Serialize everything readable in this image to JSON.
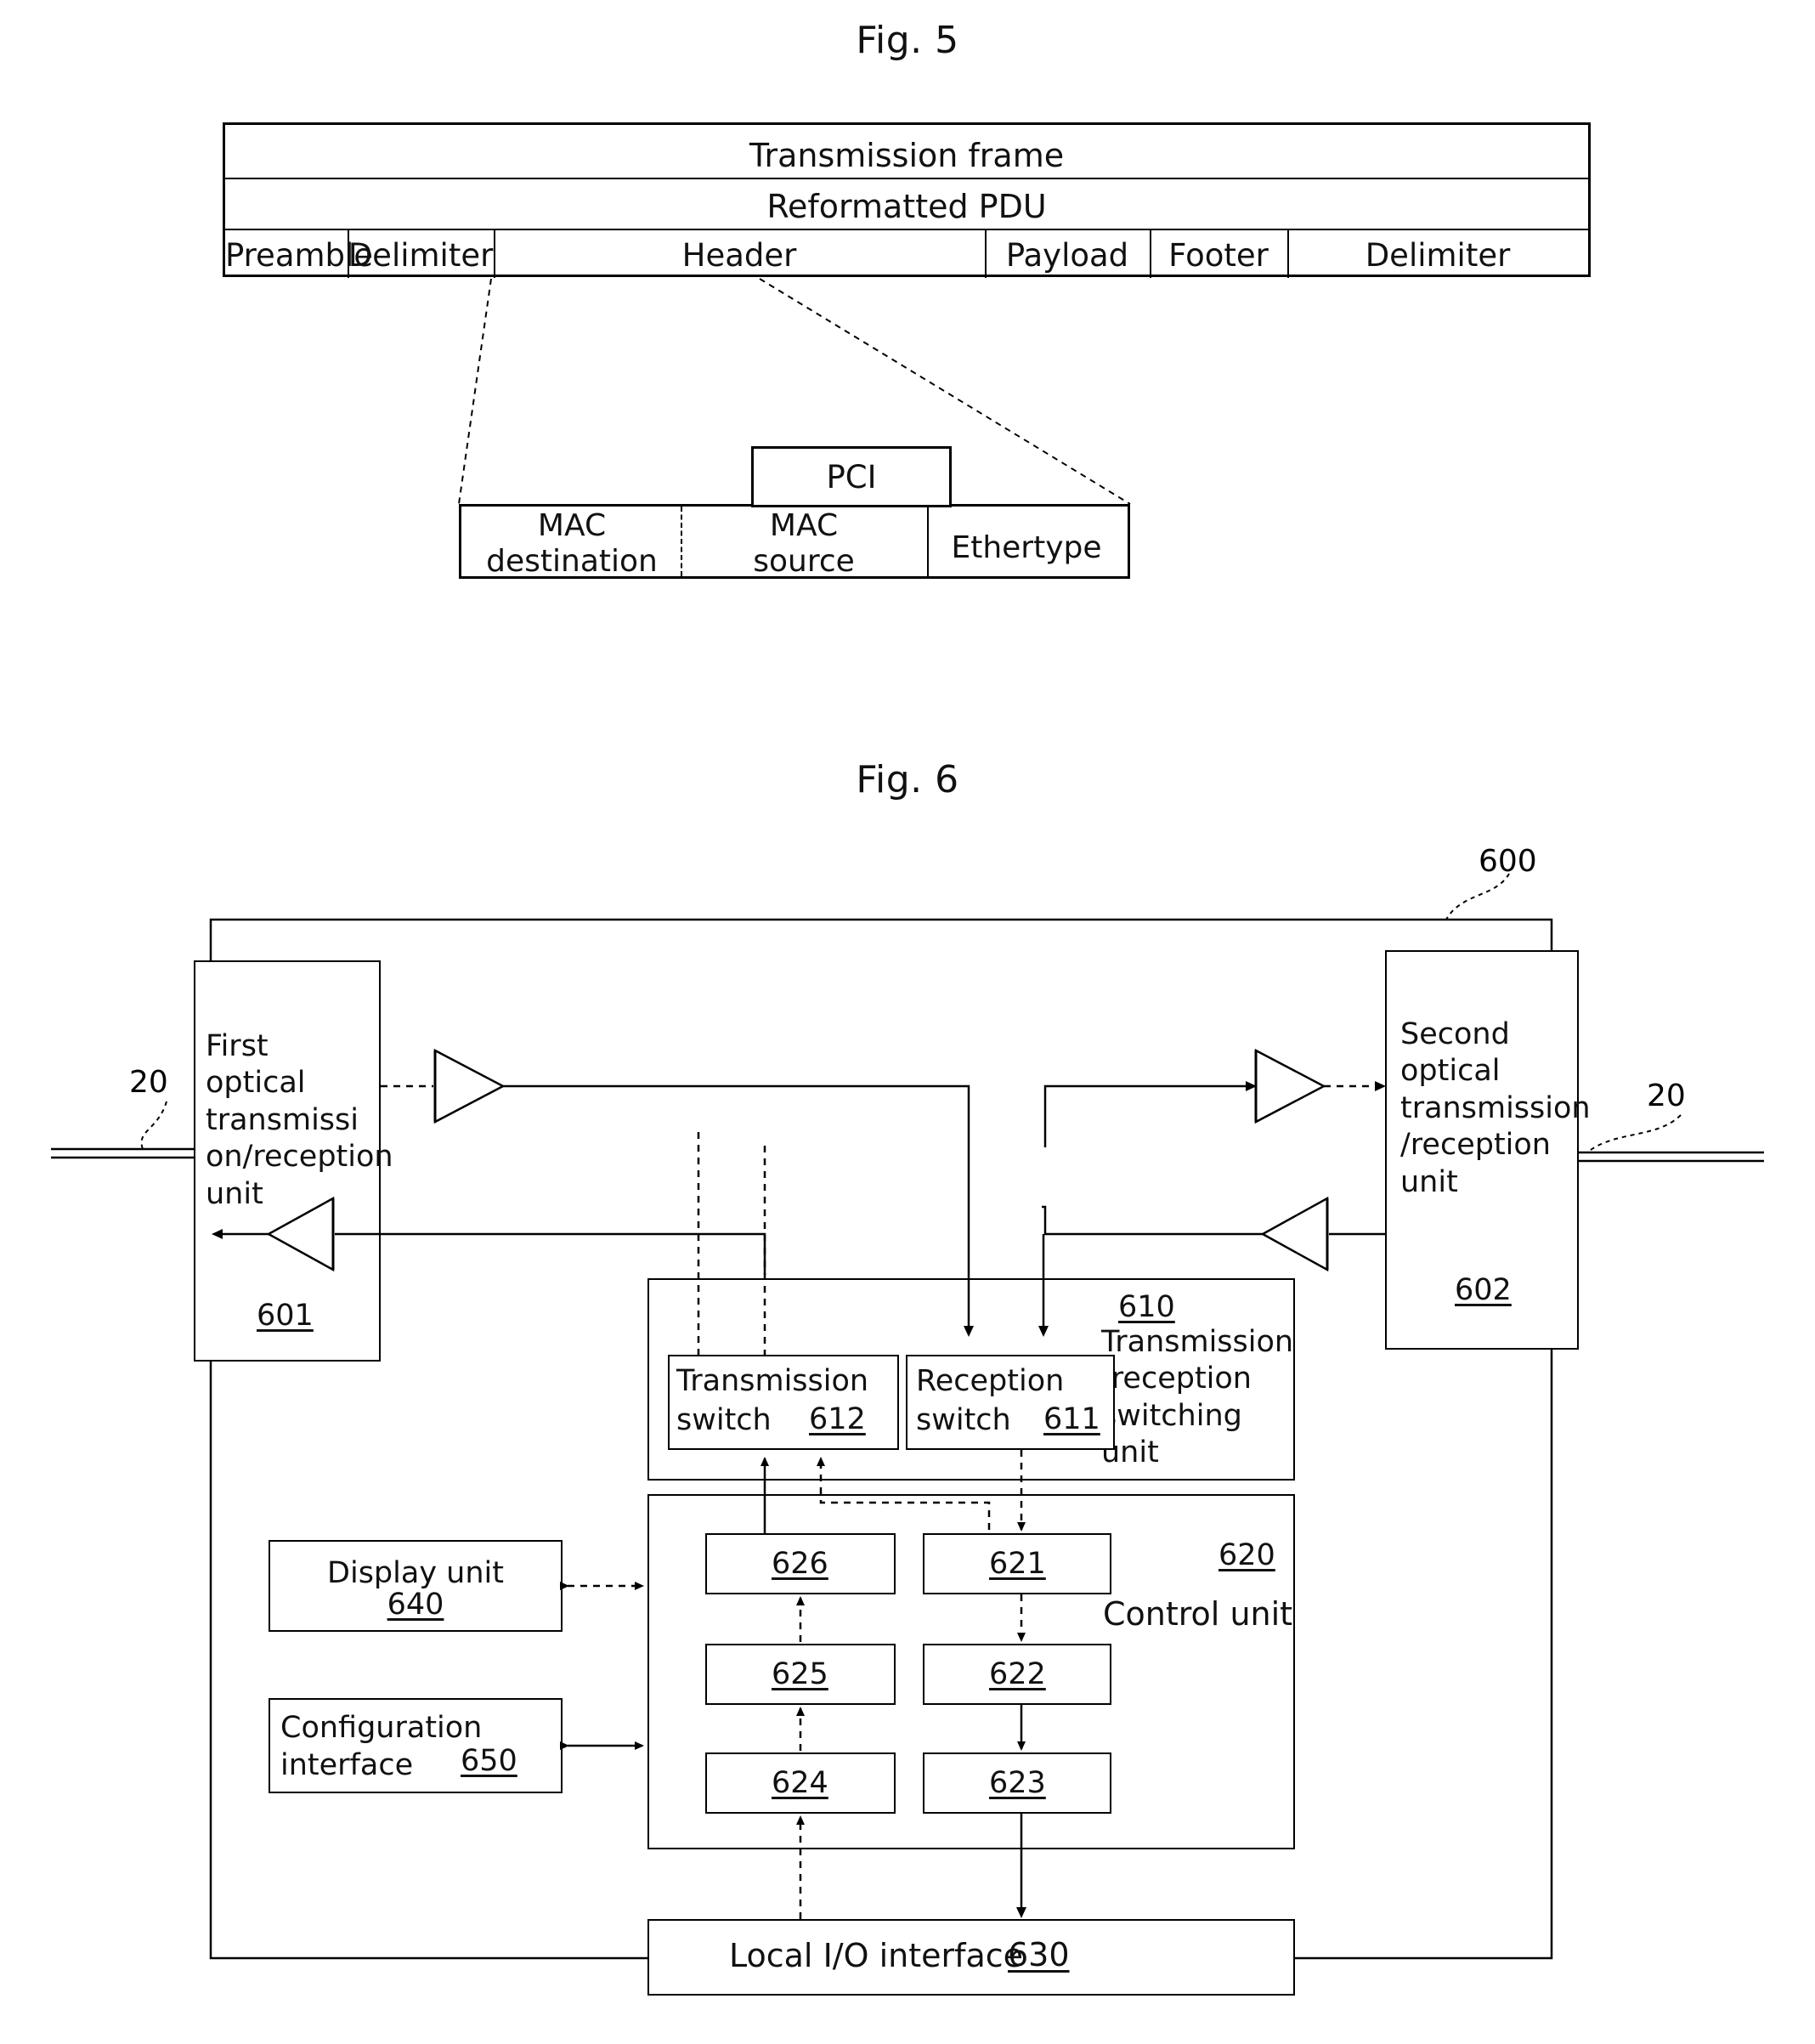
{
  "figures": {
    "fig5": {
      "title": "Fig. 5",
      "frame_rows": [
        {
          "label": "Transmission frame"
        },
        {
          "label": "Reformatted PDU"
        }
      ],
      "fields": [
        {
          "label": "Preamble"
        },
        {
          "label": "Delimiter"
        },
        {
          "label": "Header"
        },
        {
          "label": "Payload"
        },
        {
          "label": "Footer"
        },
        {
          "label": "Delimiter"
        }
      ],
      "header_detail": {
        "pci_label": "PCI",
        "fields": [
          {
            "label_line1": "MAC",
            "label_line2": "destination"
          },
          {
            "label_line1": "MAC",
            "label_line2": "source"
          },
          {
            "label_line1": "Ethertype",
            "label_line2": ""
          }
        ]
      }
    },
    "fig6": {
      "title": "Fig. 6",
      "system_ref": "600",
      "fiber_refs": {
        "left": "20",
        "right": "20"
      },
      "first_optical_unit": {
        "label": "First optical transmissi on/reception unit",
        "lines": [
          "First",
          "optical",
          "transmissi",
          "on/reception",
          "unit"
        ],
        "ref": "601"
      },
      "second_optical_unit": {
        "label": "Second optical transmission /reception unit",
        "lines": [
          "Second",
          "optical",
          "transmission",
          "/reception",
          "unit"
        ],
        "ref": "602"
      },
      "switching_unit": {
        "ref": "610",
        "lines": [
          "Transmission",
          "/reception",
          "switching",
          "unit"
        ],
        "transmission_switch": {
          "line1": "Transmission",
          "line2": "switch",
          "ref": "612"
        },
        "reception_switch": {
          "line1": "Reception",
          "line2": "switch",
          "ref": "611"
        }
      },
      "control_unit": {
        "ref": "620",
        "label": "Control unit",
        "blocks": [
          {
            "ref": "626"
          },
          {
            "ref": "621"
          },
          {
            "ref": "625"
          },
          {
            "ref": "622"
          },
          {
            "ref": "624"
          },
          {
            "ref": "623"
          }
        ]
      },
      "display_unit": {
        "line1": "Display unit",
        "ref": "640"
      },
      "configuration_interface": {
        "line1": "Configuration",
        "line2": "interface",
        "ref": "650"
      },
      "local_io_interface": {
        "label": "Local I/O interface",
        "ref": "630"
      }
    }
  }
}
